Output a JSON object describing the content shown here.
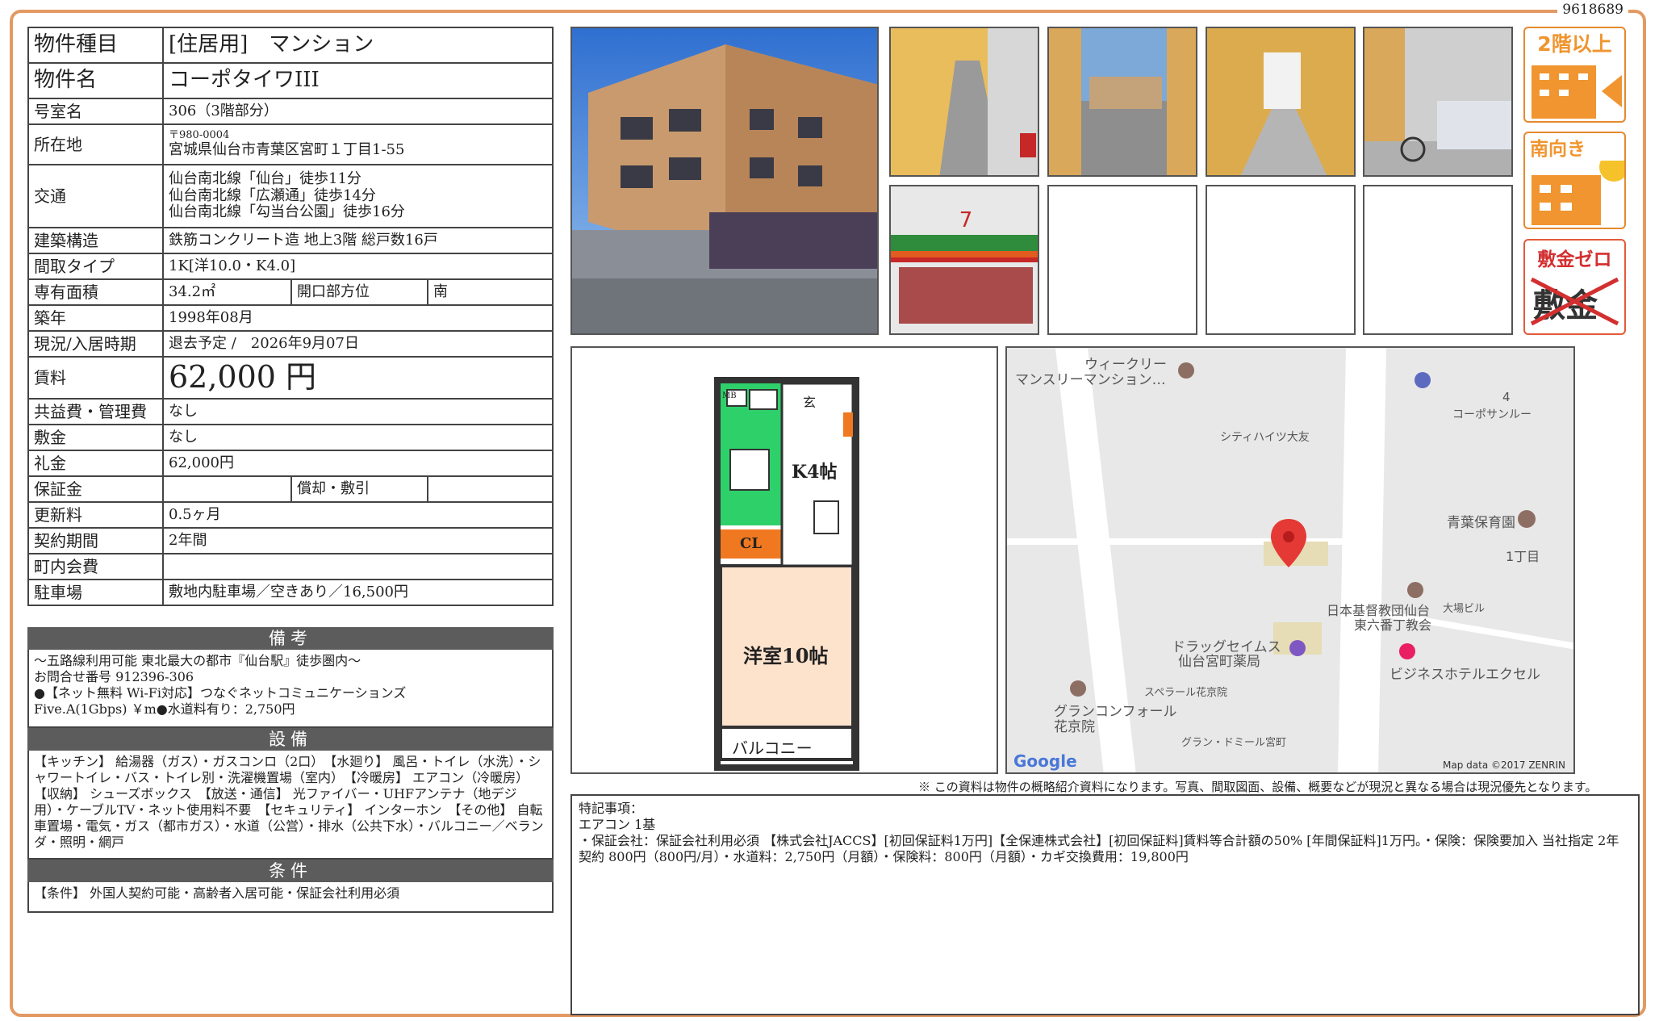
{
  "doc_id": "9618689",
  "info_rows": [
    {
      "label": "物件種目",
      "value": "[住居用]　マンション"
    },
    {
      "label": "物件名",
      "value": "コーポタイワIII"
    },
    {
      "label": "号室名",
      "value": "306（3階部分）"
    },
    {
      "label": "所在地",
      "postal": "〒980-0004",
      "value": "宮城県仙台市青葉区宮町１丁目1-55"
    },
    {
      "label": "交通",
      "lines": [
        "仙台南北線「仙台」徒歩11分",
        "仙台南北線「広瀬通」徒歩14分",
        "仙台南北線「勾当台公園」徒歩16分"
      ]
    },
    {
      "label": "建築構造",
      "value": "鉄筋コンクリート造 地上3階 総戸数16戸"
    },
    {
      "label": "間取タイプ",
      "value": "1K[洋10.0・K4.0]"
    },
    {
      "label": "専有面積",
      "value": "34.2㎡",
      "sub_label": "開口部方位",
      "sub_value": "南"
    },
    {
      "label": "築年",
      "value": "1998年08月"
    },
    {
      "label": "現況/入居時期",
      "value": "退去予定 /　2026年9月07日"
    },
    {
      "label": "賃料",
      "value": "62,000 円"
    },
    {
      "label": "共益費・管理費",
      "value": "なし"
    },
    {
      "label": "敷金",
      "value": "なし"
    },
    {
      "label": "礼金",
      "value": "62,000円"
    },
    {
      "label": "保証金",
      "value": "",
      "sub_label": "償却・敷引",
      "sub_value": ""
    },
    {
      "label": "更新料",
      "value": "0.5ヶ月"
    },
    {
      "label": "契約期間",
      "value": "2年間"
    },
    {
      "label": "町内会費",
      "value": ""
    },
    {
      "label": "駐車場",
      "value": "敷地内駐車場／空きあり／16,500円"
    }
  ],
  "biko": {
    "title": "備考",
    "lines": [
      "～五路線利用可能 東北最大の都市『仙台駅』徒歩圏内～",
      "お問合せ番号 912396-306",
      "●【ネット無料 Wi-Fi対応】つなぐネットコミュニケーションズ",
      "Five.A(1Gbps) ￥m●水道料有り：2,750円"
    ]
  },
  "setsubi": {
    "title": "設備",
    "text": "【キッチン】 給湯器（ガス）・ガスコンロ（2口）　【水廻り】 風呂・トイレ（水洗）・シャワートイレ・バス・トイレ別・洗濯機置場（室内）　【冷暖房】 エアコン（冷暖房）　【収納】 シューズボックス　【放送・通信】 光ファイバー・UHFアンテナ（地デジ用）・ケーブルTV・ネット使用料不要　【セキュリティ】 インターホン　【その他】 自転車置場・電気・ガス（都市ガス）・水道（公営）・排水（公共下水）・バルコニー／ベランダ・照明・網戸"
  },
  "joken": {
    "title": "条件",
    "text": "【条件】 外国人契約可能・高齢者入居可能・保証会社利用必須"
  },
  "badges": {
    "floor": "2階以上",
    "south": "南向き",
    "shikikin_zero": "敷金ゼロ",
    "shikikin": "敷金"
  },
  "floorplan": {
    "genkan": "玄",
    "kitchen": "K4帖",
    "closet": "CL",
    "room": "洋室10帖",
    "balcony": "バルコニー",
    "mb": "MB"
  },
  "map": {
    "labels": [
      "ウィークリー",
      "マンスリーマンション…",
      "4",
      "コーポサンルー",
      "シティハイツ大友",
      "青葉保育園",
      "1丁目",
      "日本基督教団仙台",
      "東六番丁教会",
      "大場ビル",
      "ドラッグセイムス",
      "仙台宮町薬局",
      "ビジネスホテルエクセル",
      "スペラール花京院",
      "グランコンフォール",
      "花京院",
      "グラン・ドミール宮町"
    ],
    "google": "Google",
    "credit": "Map data ©2017 ZENRIN"
  },
  "note": "※ この資料は物件の概略紹介資料になります。写真、間取図面、設備、概要などが現況と異なる場合は現況優先となります。",
  "remarks": {
    "title": "特記事項：",
    "lines": [
      "エアコン 1基",
      "・保証会社：保証会社利用必須 【株式会社JACCS】[初回保証料1万円]【全保連株式会社】[初回保証料]賃料等合計額の50% [年間保証料]1万円。・保険：保険要加入 当社指定 2年契約 800円（800円/月）・水道料：2,750円（月額）・保険料：800円（月額）・カギ交換費用：19,800円"
    ]
  },
  "colors": {
    "frame": "#e39a62",
    "badge": "#f0952f",
    "section": "#5c5c5c"
  }
}
